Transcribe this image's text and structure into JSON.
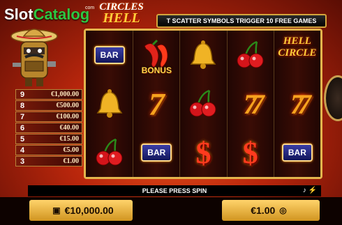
{
  "brand": {
    "slot": "Slot",
    "catalog": "Catalog"
  },
  "logo": {
    "small": "com",
    "top": "CIRCLES",
    "bottom": "HELL"
  },
  "banner": "T SCATTER SYMBOLS TRIGGER 10 FREE GAMES",
  "reels": [
    [
      "BAR",
      "BELL",
      "CHERRY"
    ],
    [
      "CHILI",
      "7",
      "BAR"
    ],
    [
      "BELL",
      "CHERRY",
      "$"
    ],
    [
      "CHERRY",
      "77",
      "$"
    ],
    [
      "HELL CIRCLE",
      "77",
      "BAR"
    ]
  ],
  "symbols": {
    "bar_label": "BAR",
    "seven": "7",
    "double_seven": "77",
    "dollar": "$",
    "bonus_label": "BONUS",
    "hell_line1": "HELL",
    "hell_line2": "CIRCLE"
  },
  "paytable": [
    {
      "n": "9",
      "v": "€1,000.00"
    },
    {
      "n": "8",
      "v": "€500.00"
    },
    {
      "n": "7",
      "v": "€100.00"
    },
    {
      "n": "6",
      "v": "€40.00"
    },
    {
      "n": "5",
      "v": "€15.00"
    },
    {
      "n": "4",
      "v": "€5.00"
    },
    {
      "n": "3",
      "v": "€1.00"
    }
  ],
  "message": "PLEASE PRESS SPIN",
  "balance": "€10,000.00",
  "bet": "€1.00",
  "icons": {
    "balance": "wallet-icon",
    "bet": "coins-icon",
    "sound": "sound-icon",
    "turbo": "lightning-icon"
  },
  "colors": {
    "frame": "#e3b54d",
    "bar_blue": "#3b3fa8",
    "gold": "#ffd36b"
  }
}
